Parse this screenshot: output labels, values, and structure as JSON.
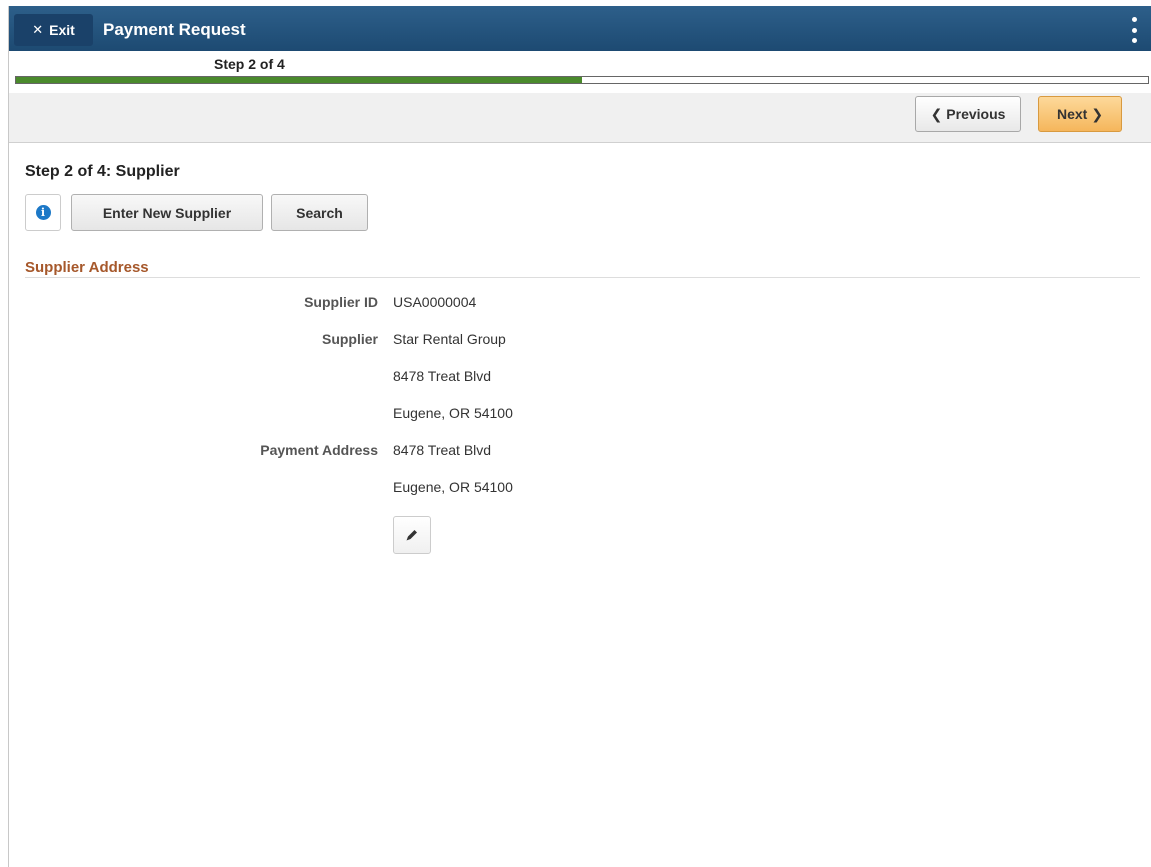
{
  "banner": {
    "exit_label": "Exit",
    "title": "Payment Request"
  },
  "progress": {
    "step_text": "Step 2 of 4",
    "current_step": 2,
    "total_steps": 4,
    "fraction_complete": 0.5,
    "fill_color": "#4a8a2c"
  },
  "nav": {
    "previous_label": "Previous",
    "next_label": "Next"
  },
  "page": {
    "title": "Step 2 of 4: Supplier",
    "enter_new_supplier_label": "Enter New Supplier",
    "search_label": "Search"
  },
  "section": {
    "header": "Supplier Address",
    "header_color": "#a6582b"
  },
  "fields": {
    "supplier_id_label": "Supplier ID",
    "supplier_id_value": "USA0000004",
    "supplier_label": "Supplier",
    "supplier_name": "Star Rental Group",
    "supplier_street": "8478 Treat Blvd",
    "supplier_city": "Eugene, OR  54100",
    "payment_address_label": "Payment Address",
    "payment_street": "8478 Treat Blvd",
    "payment_city": "Eugene, OR  54100"
  },
  "icons": {
    "exit": "close-icon",
    "menu": "kebab-menu-icon",
    "previous": "chevron-left-icon",
    "next": "chevron-right-icon",
    "info": "info-icon",
    "edit": "pencil-icon"
  }
}
